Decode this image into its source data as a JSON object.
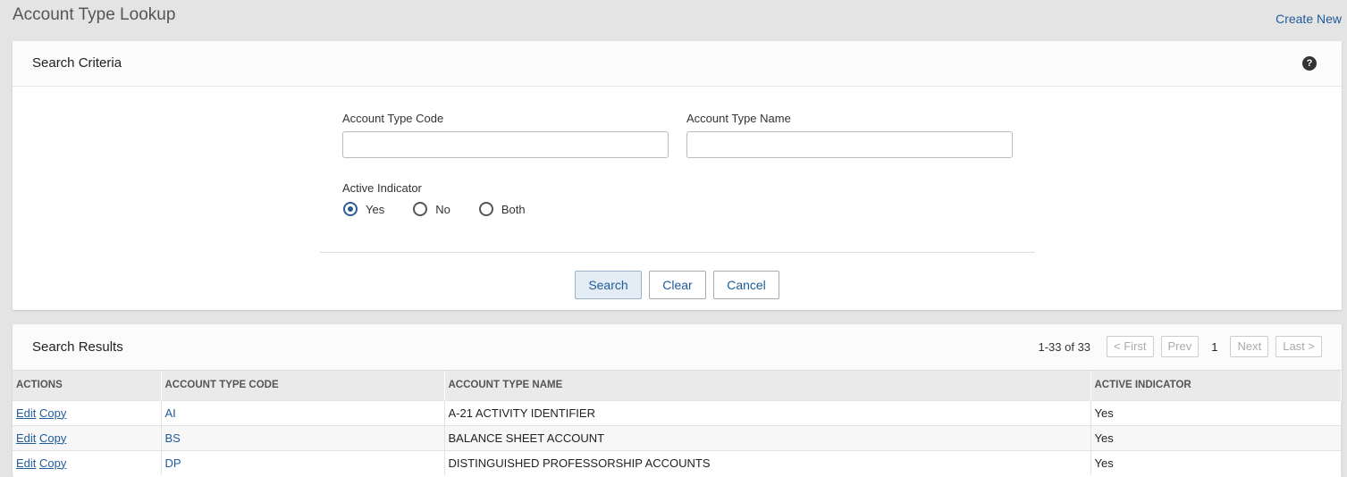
{
  "header": {
    "title": "Account Type Lookup",
    "create_new": "Create New"
  },
  "criteria": {
    "title": "Search Criteria",
    "help_glyph": "?",
    "fields": {
      "code_label": "Account Type Code",
      "code_value": "",
      "name_label": "Account Type Name",
      "name_value": ""
    },
    "active_indicator": {
      "label": "Active Indicator",
      "options": [
        "Yes",
        "No",
        "Both"
      ],
      "selected": "Yes"
    },
    "buttons": {
      "search": "Search",
      "clear": "Clear",
      "cancel": "Cancel"
    }
  },
  "results": {
    "title": "Search Results",
    "pager": {
      "range": "1-33 of 33",
      "first": "< First",
      "prev": "Prev",
      "page": "1",
      "next": "Next",
      "last": "Last >"
    },
    "columns": [
      "ACTIONS",
      "ACCOUNT TYPE CODE",
      "ACCOUNT TYPE NAME",
      "ACTIVE INDICATOR"
    ],
    "action_edit": "Edit",
    "action_copy": "Copy",
    "rows": [
      {
        "code": "AI",
        "name": "A-21 ACTIVITY IDENTIFIER",
        "active": "Yes"
      },
      {
        "code": "BS",
        "name": "BALANCE SHEET ACCOUNT",
        "active": "Yes"
      },
      {
        "code": "DP",
        "name": "DISTINGUISHED PROFESSORSHIP ACCOUNTS",
        "active": "Yes"
      }
    ]
  },
  "colors": {
    "link": "#1f5c99",
    "radio_selected": "#2a5d96",
    "background": "#e4e4e4"
  }
}
